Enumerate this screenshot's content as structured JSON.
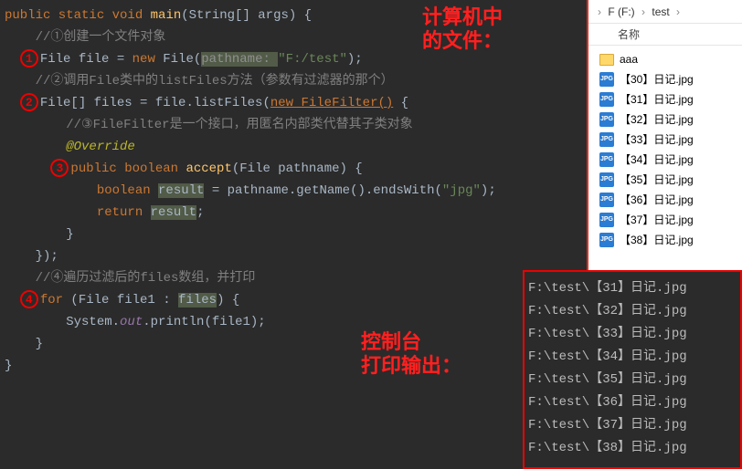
{
  "code": {
    "l1": "public static void main(String[] args) {",
    "c1": "    //①创建一个文件对象",
    "l2_a": "File file = ",
    "l2_new": "new ",
    "l2_b": "File(",
    "l2_param": "pathname: ",
    "l2_str": "\"F:/test\"",
    "l2_end": ");",
    "c2": "    //②调用File类中的listFiles方法（参数有过滤器的那个）",
    "l3_a": "File[] files = file.listFiles(",
    "l3_new": "new FileFilter()",
    "l3_end": " {",
    "c3": "        //③FileFilter是一个接口，用匿名内部类代替其子类对象",
    "ovr": "        @Override",
    "l4_a": "public boolean ",
    "l4_m": "accept",
    "l4_b": "(File pathname) {",
    "l5_a": "            boolean ",
    "l5_r": "result",
    "l5_b": " = pathname.getName().endsWith(",
    "l5_s": "\"jpg\"",
    "l5_e": ");",
    "l6_a": "            return ",
    "l6_r": "result",
    "l6_e": ";",
    "l7": "        }",
    "l8": "    });",
    "c4": "    //④遍历过滤后的files数组，并打印",
    "l9_a": "for ",
    "l9_b": "(File file1 : ",
    "l9_f": "files",
    "l9_c": ") {",
    "l10_a": "        System.",
    "l10_o": "out",
    "l10_b": ".println(file1);",
    "l11": "    }",
    "l12": "}"
  },
  "circles": {
    "1": "1",
    "2": "2",
    "3": "3",
    "4": "4"
  },
  "annotations": {
    "top": "计算机中\n的文件：",
    "mid": "控制台\n打印输出："
  },
  "breadcrumb": {
    "drive": "F (F:)",
    "folder": "test"
  },
  "columnHeader": "名称",
  "files": [
    {
      "type": "folder",
      "name": "aaa"
    },
    {
      "type": "jpg",
      "name": "【30】日记.jpg"
    },
    {
      "type": "jpg",
      "name": "【31】日记.jpg"
    },
    {
      "type": "jpg",
      "name": "【32】日记.jpg"
    },
    {
      "type": "jpg",
      "name": "【33】日记.jpg"
    },
    {
      "type": "jpg",
      "name": "【34】日记.jpg"
    },
    {
      "type": "jpg",
      "name": "【35】日记.jpg"
    },
    {
      "type": "jpg",
      "name": "【36】日记.jpg"
    },
    {
      "type": "jpg",
      "name": "【37】日记.jpg"
    },
    {
      "type": "jpg",
      "name": "【38】日记.jpg"
    }
  ],
  "jpgLabel": "JPG",
  "console": [
    "F:\\test\\【31】日记.jpg",
    "F:\\test\\【32】日记.jpg",
    "F:\\test\\【33】日记.jpg",
    "F:\\test\\【34】日记.jpg",
    "F:\\test\\【35】日记.jpg",
    "F:\\test\\【36】日记.jpg",
    "F:\\test\\【37】日记.jpg",
    "F:\\test\\【38】日记.jpg"
  ]
}
